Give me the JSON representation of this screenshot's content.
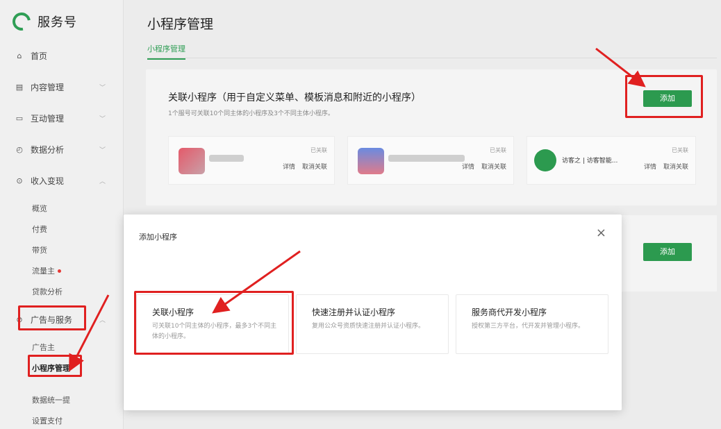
{
  "sidebar": {
    "brand": "服务号",
    "items": [
      {
        "label": "首页",
        "icon": "home-icon"
      },
      {
        "label": "内容管理",
        "icon": "document-icon"
      },
      {
        "label": "互动管理",
        "icon": "chat-icon"
      },
      {
        "label": "数据分析",
        "icon": "clock-icon"
      },
      {
        "label": "收入变现",
        "icon": "coin-icon"
      },
      {
        "label": "广告与服务",
        "icon": "compass-icon"
      }
    ],
    "sub_items_income": [
      "概览",
      "付费",
      "带货",
      "流量主",
      "贷款分析"
    ],
    "sub_items_ad": [
      "广告主",
      "小程序管理",
      "数据统一提",
      "设置支付"
    ]
  },
  "main": {
    "title": "小程序管理",
    "tab": "小程序管理",
    "card": {
      "title": "关联小程序（用于自定义菜单、模板消息和附近的小程序）",
      "desc": "1个服号可关联10个同主体的小程序及3个不同主体小程序。",
      "add_button": "添加",
      "minis": [
        {
          "status": "已关联",
          "detail": "详情",
          "unlink": "取消关联",
          "name": ""
        },
        {
          "status": "已关联",
          "detail": "详情",
          "unlink": "取消关联",
          "name": ""
        },
        {
          "status": "已关联",
          "detail": "详情",
          "unlink": "取消关联",
          "name": "访客之 | 访客智能..."
        }
      ]
    },
    "card2": {
      "add_button": "添加"
    }
  },
  "modal": {
    "title": "添加小程序",
    "close": "×",
    "options": [
      {
        "title": "关联小程序",
        "desc": "可关联10个同主体的小程序，最多3个不同主体的小程序。"
      },
      {
        "title": "快速注册并认证小程序",
        "desc": "复用公众号资质快速注册并认证小程序。"
      },
      {
        "title": "服务商代开发小程序",
        "desc": "授权第三方平台，代开发并管理小程序。"
      }
    ]
  },
  "colors": {
    "accent": "#2c9a4f",
    "highlight": "#e02020"
  }
}
